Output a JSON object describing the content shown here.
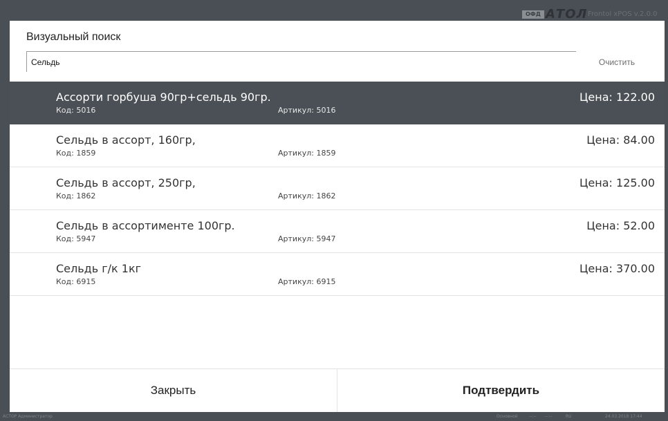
{
  "app": {
    "ofd_badge": "ОФД",
    "logo_text": "АТОЛ",
    "version": "Frontol xPOS v.2.0.0"
  },
  "dialog": {
    "title": "Визуальный поиск",
    "search": {
      "value": "Сельдь",
      "placeholder": ""
    },
    "clear_label": "Очистить",
    "items": [
      {
        "name": "Ассорти горбуша 90гр+сельдь 90гр.",
        "code": "Код: 5016",
        "article": "Артикул: 5016",
        "price": "Цена: 122.00",
        "selected": true
      },
      {
        "name": "Сельдь в ассорт, 160гр,",
        "code": "Код: 1859",
        "article": "Артикул: 1859",
        "price": "Цена: 84.00",
        "selected": false
      },
      {
        "name": "Сельдь в ассорт, 250гр,",
        "code": "Код: 1862",
        "article": "Артикул: 1862",
        "price": "Цена: 125.00",
        "selected": false
      },
      {
        "name": "Сельдь в ассортименте 100гр.",
        "code": "Код: 5947",
        "article": "Артикул: 5947",
        "price": "Цена: 52.00",
        "selected": false
      },
      {
        "name": "Сельдь г/к 1кг",
        "code": "Код: 6915",
        "article": "Артикул: 6915",
        "price": "Цена: 370.00",
        "selected": false
      }
    ],
    "close_label": "Закрыть",
    "confirm_label": "Подтвердить"
  },
  "statusbar": {
    "user": "АСТОР Администратор",
    "mode": "Основной",
    "indicator1": "--:--",
    "indicator2": "--:--",
    "language": "RU",
    "datetime": "24.03.2018 17:44"
  },
  "colors": {
    "selected_row": "#4a5056",
    "background": "#4a4f55"
  }
}
